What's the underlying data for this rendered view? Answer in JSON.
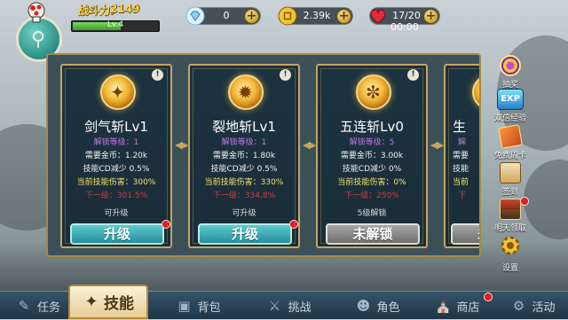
{
  "hud": {
    "power_label": "战斗力:",
    "power_value": "2149",
    "level_text": "Lv.4",
    "level_progress": 0.55,
    "gems": "0",
    "gold": "2.39k",
    "stamina": "17/20",
    "timer": "00:00"
  },
  "cards": [
    {
      "name": "剑气斩Lv1",
      "unlock_level": "解锁等级：1",
      "cost": "需要金币：1.20k",
      "cd": "技能CD减少 0.5%",
      "damage": "当前技能伤害：300%",
      "next": "下一级：301.5%",
      "status": "可升级",
      "button": "升级",
      "button_state": "upgrade",
      "icon": "sword-qi-icon"
    },
    {
      "name": "裂地斩Lv1",
      "unlock_level": "解锁等级：1",
      "cost": "需要金币：1.80k",
      "cd": "技能CD减少 0.5%",
      "damage": "当前技能伤害：330%",
      "next": "下一级：334.8%",
      "status": "可升级",
      "button": "升级",
      "button_state": "upgrade",
      "icon": "ground-split-icon"
    },
    {
      "name": "五连斩Lv0",
      "unlock_level": "解锁等级：5",
      "cost": "需要金币：3.00k",
      "cd": "技能CD减少 0%",
      "damage": "当前技能伤害：0%",
      "next": "下一级：250%",
      "status": "5级解锁",
      "button": "未解锁",
      "button_state": "locked",
      "icon": "five-slash-icon"
    },
    {
      "name": "生",
      "unlock_level": "解",
      "cost": "需要",
      "cd": "技能",
      "damage": "当前",
      "next": "下",
      "status": "",
      "button": "未",
      "button_state": "locked",
      "icon": "partial-skill-icon"
    }
  ],
  "side_menu": [
    {
      "label": "抽奖",
      "icon": "lottery-icon"
    },
    {
      "label": "双倍经验",
      "icon": "exp-icon",
      "icon_text": "EXP"
    },
    {
      "label": "免费周卡",
      "icon": "weekly-card-icon"
    },
    {
      "label": "签到",
      "icon": "sign-in-icon"
    },
    {
      "label": "明天领取",
      "icon": "treasure-chest-icon"
    },
    {
      "label": "设置",
      "icon": "gear-icon"
    }
  ],
  "nav": {
    "task": "任务",
    "skill": "技能",
    "bag": "背包",
    "challenge": "挑战",
    "role": "角色",
    "shop": "商店",
    "event": "活动"
  },
  "colors": {
    "upgrade_button": "#2a8d96",
    "locked_button": "#6f6f6f",
    "panel_border": "#c7a55e",
    "unlock_level_text": "#c077e6",
    "next_level_text": "#d33a3a"
  }
}
